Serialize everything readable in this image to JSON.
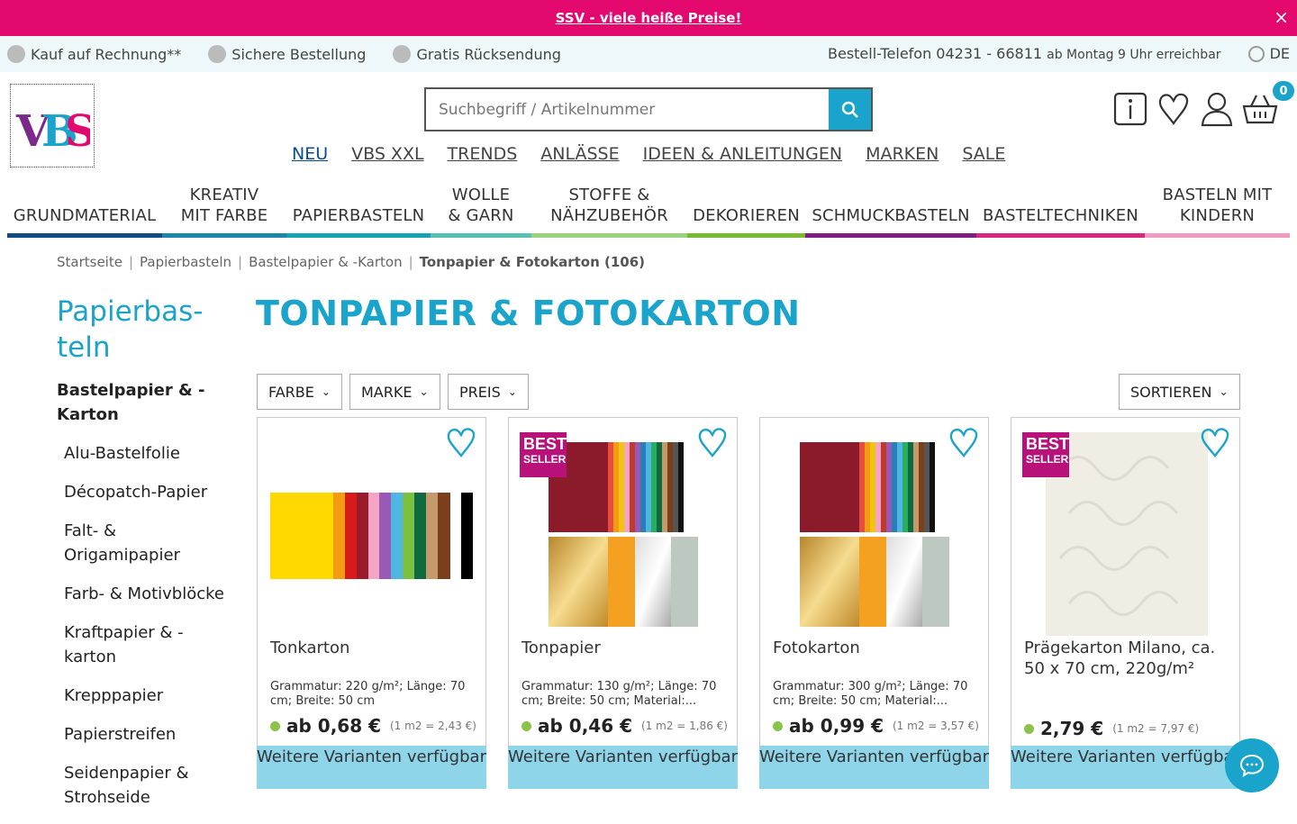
{
  "promo": {
    "text": "SSV - viele heiße Preise!",
    "close": "×"
  },
  "infobar": {
    "usps": [
      "Kauf auf Rechnung**",
      "Sichere Bestellung",
      "Gratis Rücksendung"
    ],
    "phone_label": "Bestell-Telefon 04231 - 66811",
    "phone_hours": "ab Montag 9 Uhr erreichbar",
    "language": "DE"
  },
  "search": {
    "placeholder": "Suchbegriff / Artikelnummer"
  },
  "cart": {
    "count": "0"
  },
  "topnav": [
    "NEU",
    "VBS XXL",
    "TRENDS",
    "ANLÄSSE",
    "IDEEN & ANLEITUNGEN",
    "MARKEN",
    "SALE"
  ],
  "categories": [
    {
      "label": "GRUNDMATERIAL",
      "color": "#0f4c81"
    },
    {
      "label": "KREATIV\nMIT FARBE",
      "color": "#1b86a7"
    },
    {
      "label": "PAPIERBASTELN",
      "color": "#14a3b0"
    },
    {
      "label": "WOLLE\n& GARN",
      "color": "#58bfb3"
    },
    {
      "label": "STOFFE &\nNÄHZUBEHÖR",
      "color": "#9bd27d"
    },
    {
      "label": "DEKORIEREN",
      "color": "#7ab930"
    },
    {
      "label": "SCHMUCKBASTELN",
      "color": "#7d1e83"
    },
    {
      "label": "BASTELTECHNIKEN",
      "color": "#d8277e"
    },
    {
      "label": "BASTELN MIT\nKINDERN",
      "color": "#f29bc2"
    }
  ],
  "breadcrumb": [
    "Startseite",
    "Papierbasteln",
    "Bastelpapier & -Karton"
  ],
  "breadcrumb_current": "Tonpapier & Fotokarton (106)",
  "sidebar": {
    "title": "Papierbas-teln",
    "subtitle": "Bastelpapier & -Karton",
    "items": [
      "Alu-Bastelfolie",
      "Décopatch-Papier",
      "Falt- & Origamipapier",
      "Farb- & Motivblöcke",
      "Kraftpapier & -karton",
      "Krepppapier",
      "Papierstreifen",
      "Seidenpapier & Strohseide"
    ]
  },
  "page_title": "TONPAPIER & FOTOKARTON",
  "filters": [
    "FARBE",
    "MARKE",
    "PREIS"
  ],
  "sort": "SORTIEREN",
  "products": [
    {
      "name": "Tonkarton",
      "desc": "Grammatur: 220 g/m²; Länge: 70 cm; Breite: 50 cm",
      "price": "ab 0,68 €",
      "unit": "(1 m2 = 2,43 €)",
      "bestseller": false,
      "variants": "Weitere Varianten verfügbar"
    },
    {
      "name": "Tonpapier",
      "desc": "Grammatur: 130 g/m²; Länge: 70 cm; Breite: 50 cm; Material:...",
      "price": "ab 0,46 €",
      "unit": "(1 m2 = 1,86 €)",
      "bestseller": true,
      "variants": "Weitere Varianten verfügbar"
    },
    {
      "name": "Fotokarton",
      "desc": "Grammatur: 300 g/m²; Länge: 70 cm; Breite: 50 cm; Material:...",
      "price": "ab 0,99 €",
      "unit": "(1 m2 = 3,57 €)",
      "bestseller": false,
      "variants": "Weitere Varianten verfügbar"
    },
    {
      "name": "Prägekarton Milano, ca. 50 x 70 cm, 220g/m²",
      "desc": "",
      "price": "2,79 €",
      "unit": "(1 m2 = 7,97 €)",
      "bestseller": true,
      "variants": "Weitere Varianten verfügbar"
    }
  ],
  "bestseller_label": {
    "line1": "BEST",
    "line2": "SELLER"
  },
  "icons": {
    "info": "info-icon",
    "wishlist": "heart-icon",
    "account": "user-icon",
    "cart": "basket-icon",
    "search": "search-icon",
    "chat": "chat-icon"
  }
}
